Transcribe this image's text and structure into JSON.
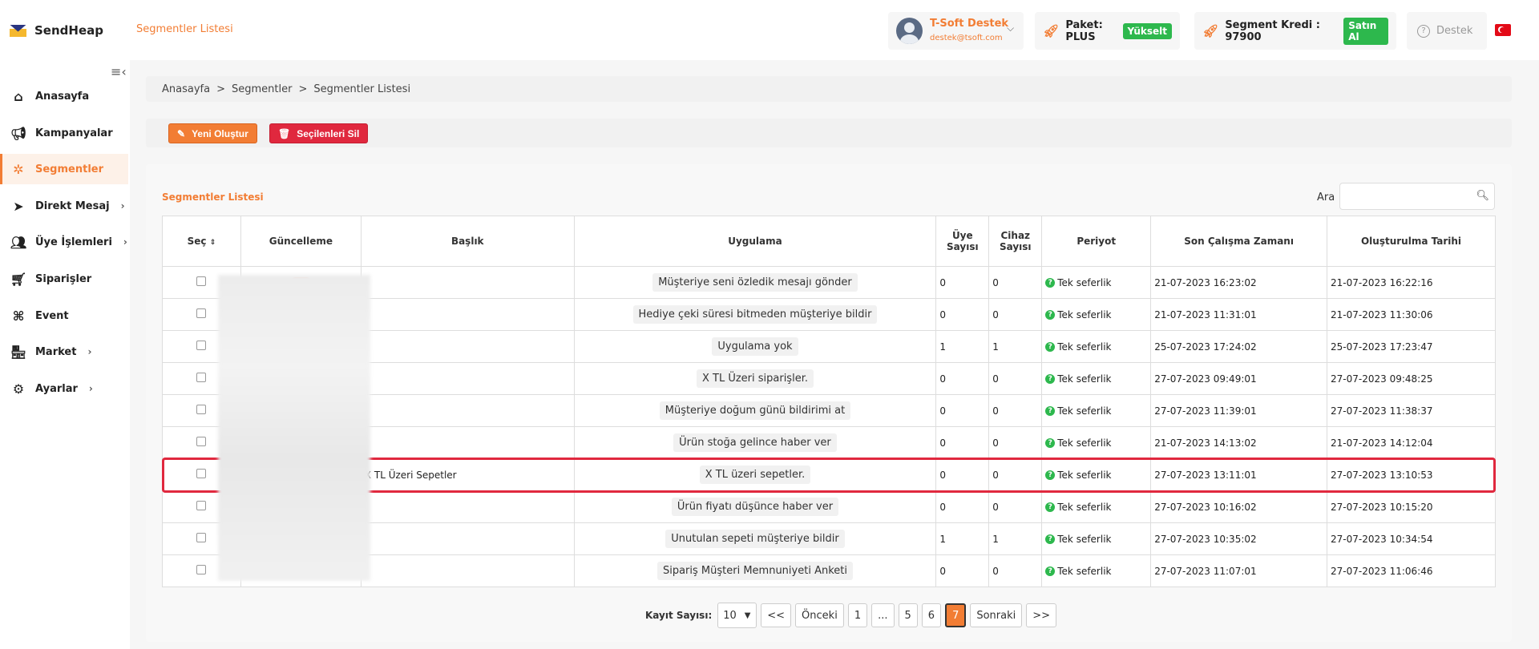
{
  "app": {
    "name": "SendHeap",
    "page_title": "Segmentler Listesi"
  },
  "user": {
    "name": "T-Soft Destek",
    "email": "destek@tsoft.com"
  },
  "plan": {
    "label": "Paket: PLUS",
    "badge": "Yükselt"
  },
  "credit": {
    "label": "Segment Kredi : 97900",
    "badge": "Satın Al"
  },
  "support": {
    "label": "Destek"
  },
  "sidebar": {
    "items": [
      {
        "label": "Anasayfa",
        "icon": "home-icon"
      },
      {
        "label": "Kampanyalar",
        "icon": "megaphone-icon"
      },
      {
        "label": "Segmentler",
        "icon": "nodes-icon",
        "active": true
      },
      {
        "label": "Direkt Mesaj",
        "icon": "send-icon",
        "has_children": true
      },
      {
        "label": "Üye İşlemleri",
        "icon": "users-icon",
        "has_children": true
      },
      {
        "label": "Siparişler",
        "icon": "cart-icon"
      },
      {
        "label": "Event",
        "icon": "command-icon"
      },
      {
        "label": "Market",
        "icon": "store-icon",
        "has_children": true
      },
      {
        "label": "Ayarlar",
        "icon": "gear-icon",
        "has_children": true
      }
    ]
  },
  "breadcrumb": [
    "Anasayfa",
    "Segmentler",
    "Segmentler Listesi"
  ],
  "actions": {
    "create": "Yeni Oluştur",
    "delete_selected": "Seçilenleri Sil"
  },
  "card": {
    "title": "Segmentler Listesi",
    "search_label": "Ara",
    "search_value": ""
  },
  "table": {
    "headers": {
      "select": "Seç",
      "update": "Güncelleme",
      "title": "Başlık",
      "app": "Uygulama",
      "members": "Üye Sayısı",
      "devices": "Cihaz Sayısı",
      "period": "Periyot",
      "last_run": "Son Çalışma Zamanı",
      "created": "Oluşturulma Tarihi"
    },
    "rows": [
      {
        "title": "",
        "app": "Müşteriye seni özledik mesajı gönder",
        "members": "0",
        "devices": "0",
        "period": "Tek seferlik",
        "last_run": "21-07-2023 16:23:02",
        "created": "21-07-2023 16:22:16"
      },
      {
        "title": "",
        "app": "Hediye çeki süresi bitmeden müşteriye bildir",
        "members": "0",
        "devices": "0",
        "period": "Tek seferlik",
        "last_run": "21-07-2023 11:31:01",
        "created": "21-07-2023 11:30:06"
      },
      {
        "title": "",
        "app": "Uygulama yok",
        "members": "1",
        "devices": "1",
        "period": "Tek seferlik",
        "last_run": "25-07-2023 17:24:02",
        "created": "25-07-2023 17:23:47"
      },
      {
        "title": "",
        "app": "X TL Üzeri siparişler.",
        "members": "0",
        "devices": "0",
        "period": "Tek seferlik",
        "last_run": "27-07-2023 09:49:01",
        "created": "27-07-2023 09:48:25"
      },
      {
        "title": "",
        "app": "Müşteriye doğum günü bildirimi at",
        "members": "0",
        "devices": "0",
        "period": "Tek seferlik",
        "last_run": "27-07-2023 11:39:01",
        "created": "27-07-2023 11:38:37"
      },
      {
        "title": "",
        "app": "Ürün stoğa gelince haber ver",
        "members": "0",
        "devices": "0",
        "period": "Tek seferlik",
        "last_run": "21-07-2023 14:13:02",
        "created": "21-07-2023 14:12:04"
      },
      {
        "title": "X TL Üzeri Sepetler",
        "app": "X TL üzeri sepetler.",
        "members": "0",
        "devices": "0",
        "period": "Tek seferlik",
        "last_run": "27-07-2023 13:11:01",
        "created": "27-07-2023 13:10:53"
      },
      {
        "title": "",
        "app": "Ürün fiyatı düşünce haber ver",
        "members": "0",
        "devices": "0",
        "period": "Tek seferlik",
        "last_run": "27-07-2023 10:16:02",
        "created": "27-07-2023 10:15:20"
      },
      {
        "title": "",
        "app": "Unutulan sepeti müşteriye bildir",
        "members": "1",
        "devices": "1",
        "period": "Tek seferlik",
        "last_run": "27-07-2023 10:35:02",
        "created": "27-07-2023 10:34:54"
      },
      {
        "title": "",
        "app": "Sipariş Müşteri Memnuniyeti Anketi",
        "members": "0",
        "devices": "0",
        "period": "Tek seferlik",
        "last_run": "27-07-2023 11:07:01",
        "created": "27-07-2023 11:06:46"
      }
    ]
  },
  "pagination": {
    "label": "Kayıt Sayısı:",
    "page_size": "10",
    "first": "<<",
    "prev": "Önceki",
    "pages": [
      "1",
      "...",
      "5",
      "6",
      "7"
    ],
    "current": "7",
    "next": "Sonraki",
    "last": ">>"
  },
  "colors": {
    "accent": "#f27d34",
    "danger": "#e0283e",
    "success": "#2db84d"
  }
}
